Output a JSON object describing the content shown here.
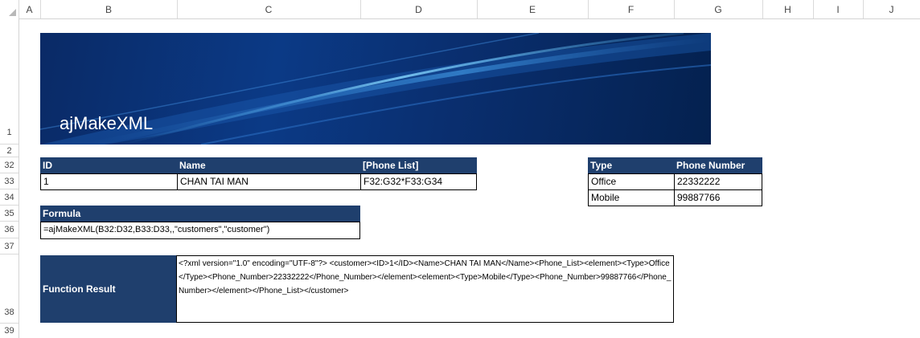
{
  "sheet": {
    "columns": [
      "A",
      "B",
      "C",
      "D",
      "E",
      "F",
      "G",
      "H",
      "I",
      "J"
    ],
    "rows": [
      "1",
      "2",
      "32",
      "33",
      "34",
      "35",
      "36",
      "37",
      "38",
      "39"
    ]
  },
  "banner": {
    "title": "ajMakeXML"
  },
  "customer_table": {
    "headers": [
      "ID",
      "Name",
      "[Phone List]"
    ],
    "row": [
      "1",
      "CHAN TAI MAN",
      "F32:G32*F33:G34"
    ]
  },
  "phone_table": {
    "headers": [
      "Type",
      "Phone Number"
    ],
    "rows": [
      [
        "Office",
        "22332222"
      ],
      [
        "Mobile",
        "99887766"
      ]
    ]
  },
  "formula": {
    "header": "Formula",
    "value": "=ajMakeXML(B32:D32,B33:D33,,\"customers\",\"customer\")"
  },
  "result": {
    "label": "Function Result",
    "value": "<?xml version=\"1.0\" encoding=\"UTF-8\"?> <customer><ID>1</ID><Name>CHAN TAI MAN</Name><Phone_List><element><Type>Office</Type><Phone_Number>22332222</Phone_Number></element><element><Type>Mobile</Type><Phone_Number>99887766</Phone_Number></element></Phone_List></customer>"
  }
}
